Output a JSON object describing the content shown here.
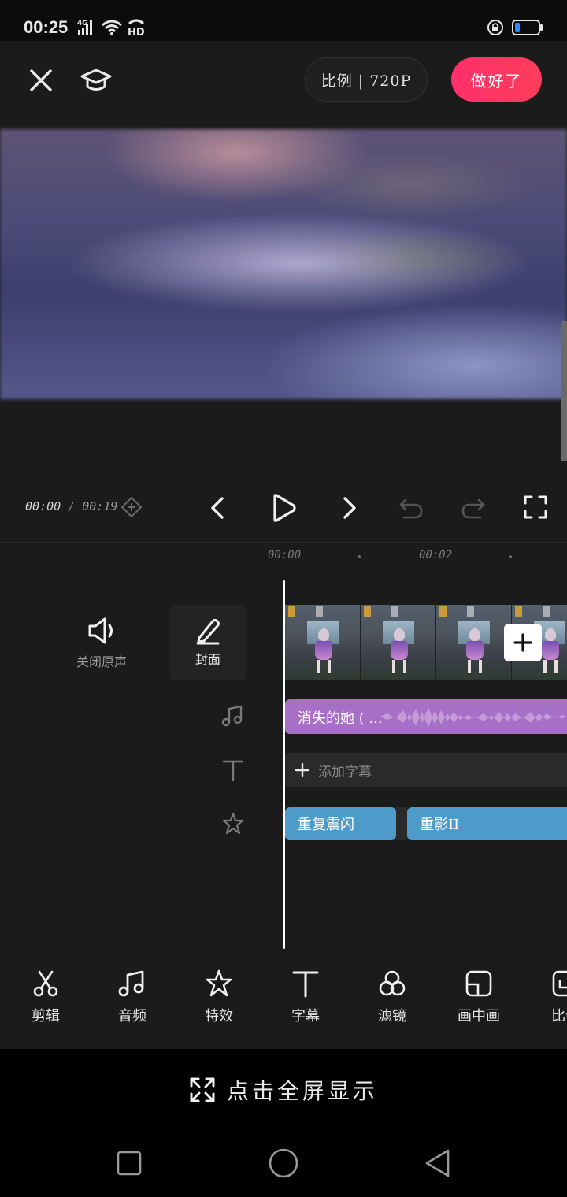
{
  "status_bar": {
    "time": "00:25",
    "network": "4G",
    "hd": "HD"
  },
  "toolbar": {
    "ratio_label": "比例 | 720P",
    "done_label": "做好了"
  },
  "player": {
    "current_time": "00:00",
    "separator": "/",
    "total_time": "00:19"
  },
  "timeline": {
    "ruler": [
      "00:00",
      "00:02"
    ],
    "mute_label": "关闭原声",
    "cover_label": "封面",
    "audio_clip_label": "消失的她 ( ...",
    "subtitle_add_label": "添加字幕",
    "effects": [
      {
        "label": "重复震闪"
      },
      {
        "label": "重影II"
      }
    ]
  },
  "tools": [
    {
      "label": "剪辑",
      "icon": "scissors-icon"
    },
    {
      "label": "音频",
      "icon": "music-note-icon"
    },
    {
      "label": "特效",
      "icon": "sparkle-star-icon"
    },
    {
      "label": "字幕",
      "icon": "text-t-icon"
    },
    {
      "label": "滤镜",
      "icon": "filter-circles-icon"
    },
    {
      "label": "画中画",
      "icon": "picture-in-picture-icon"
    },
    {
      "label": "比例",
      "icon": "ratio-icon"
    }
  ],
  "fullscreen_hint": "点击全屏显示",
  "colors": {
    "accent": "#ff2f6a",
    "audio_clip": "#a86fc6",
    "effect_clip": "#4e9bc9",
    "background": "#1b1b1b"
  }
}
